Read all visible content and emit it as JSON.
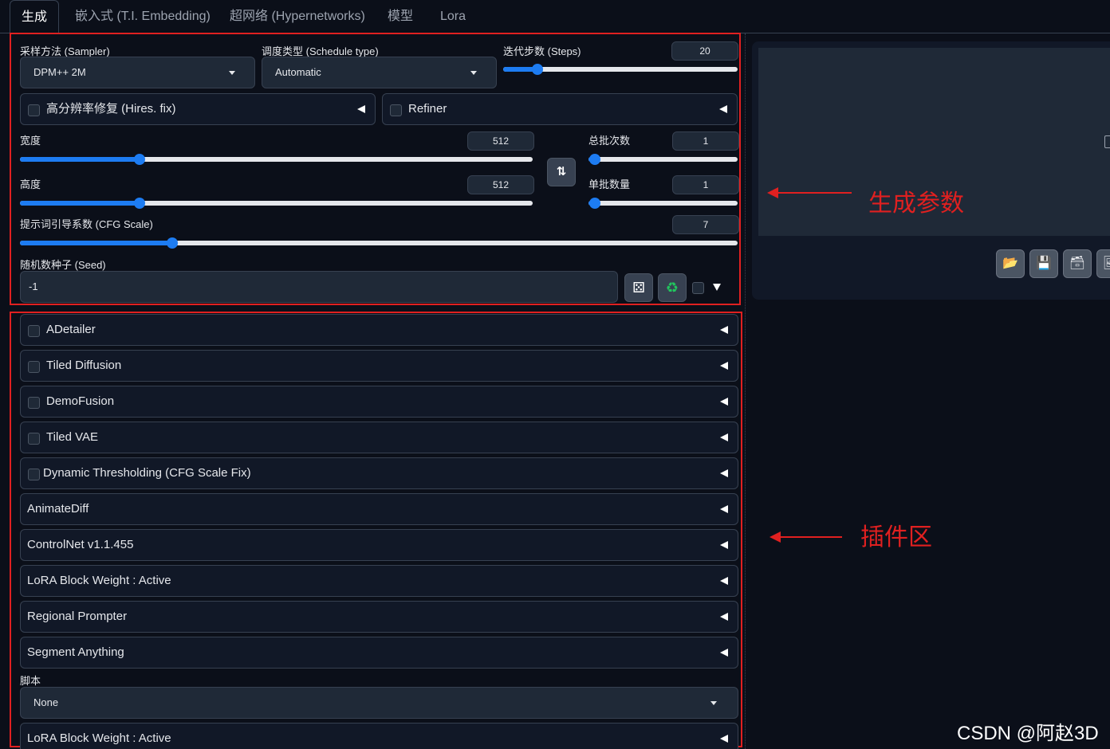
{
  "tabs": [
    "生成",
    "嵌入式 (T.I. Embedding)",
    "超网络 (Hypernetworks)",
    "模型",
    "Lora"
  ],
  "sampler": {
    "label": "采样方法 (Sampler)",
    "value": "DPM++ 2M"
  },
  "schedule": {
    "label": "调度类型 (Schedule type)",
    "value": "Automatic"
  },
  "steps": {
    "label": "迭代步数 (Steps)",
    "value": "20",
    "level": 0.04
  },
  "hires": {
    "label": "高分辨率修复 (Hires. fix)"
  },
  "refiner": {
    "label": "Refiner"
  },
  "width": {
    "label": "宽度",
    "value": "512",
    "level": 0.2
  },
  "height": {
    "label": "高度",
    "value": "512",
    "level": 0.2
  },
  "batch_count": {
    "label": "总批次数",
    "value": "1",
    "level": 0.0
  },
  "batch_size": {
    "label": "单批数量",
    "value": "1",
    "level": 0.0
  },
  "cfg": {
    "label": "提示词引导系数 (CFG Scale)",
    "value": "7",
    "level": 0.21
  },
  "seed": {
    "label": "随机数种子 (Seed)",
    "value": "-1"
  },
  "extensions": [
    {
      "label": "ADetailer",
      "checkbox": true
    },
    {
      "label": "Tiled Diffusion",
      "checkbox": true
    },
    {
      "label": "DemoFusion",
      "checkbox": true
    },
    {
      "label": "Tiled VAE",
      "checkbox": true
    },
    {
      "label": "Dynamic Thresholding (CFG Scale Fix)",
      "checkbox": true
    },
    {
      "label": "AnimateDiff",
      "checkbox": false
    },
    {
      "label": "ControlNet v1.1.455",
      "checkbox": false
    },
    {
      "label": "LoRA Block Weight : Active",
      "checkbox": false
    },
    {
      "label": "Regional Prompter",
      "checkbox": false
    },
    {
      "label": "Segment Anything",
      "checkbox": false
    }
  ],
  "script": {
    "label": "脚本",
    "value": "None"
  },
  "extra_panel": {
    "label": "LoRA Block Weight : Active"
  },
  "annotations": {
    "params": "生成参数",
    "plugins": "插件区"
  },
  "watermark": "CSDN @阿赵3D",
  "colors": {
    "accent": "#1d7cf2",
    "annotation": "#e02020",
    "background": "#0b0f19"
  },
  "icons": [
    "swap-dimensions-icon",
    "dice-icon",
    "recycle-icon",
    "folder-icon",
    "save-icon",
    "zip-icon",
    "image-icon"
  ]
}
